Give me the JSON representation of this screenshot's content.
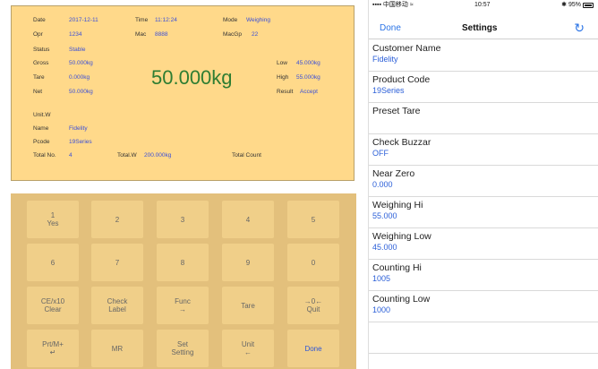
{
  "display": {
    "date_label": "Date",
    "date": "2017-12-11",
    "time_label": "Time",
    "time": "11:12:24",
    "mode_label": "Mode",
    "mode": "Weighing",
    "opr_label": "Opr",
    "opr": "1234",
    "mac_label": "Mac",
    "mac": "8888",
    "macgp_label": "MacGp",
    "macgp": "22",
    "status_label": "Status",
    "status": "Stable",
    "gross_label": "Gross",
    "gross": "50.000kg",
    "tare_label": "Tare",
    "tare": "0.000kg",
    "net_label": "Net",
    "net": "50.000kg",
    "big_weight": "50.000kg",
    "low_label": "Low",
    "low": "45.000kg",
    "high_label": "High",
    "high": "55.000kg",
    "result_label": "Result",
    "result": "Accept",
    "unitw_label": "Unit.W",
    "name_label": "Name",
    "name": "Fidelity",
    "pcode_label": "Pcode",
    "pcode": "19Series",
    "totalno_label": "Total No.",
    "totalno": "4",
    "totalw_label": "Total.W",
    "totalw": "200.000kg",
    "totalcount_label": "Total Count"
  },
  "keypad": {
    "keys": [
      {
        "l1": "1",
        "l2": "Yes"
      },
      {
        "l1": "2",
        "l2": ""
      },
      {
        "l1": "3",
        "l2": ""
      },
      {
        "l1": "4",
        "l2": ""
      },
      {
        "l1": "5",
        "l2": ""
      },
      {
        "l1": "6",
        "l2": ""
      },
      {
        "l1": "7",
        "l2": ""
      },
      {
        "l1": "8",
        "l2": ""
      },
      {
        "l1": "9",
        "l2": ""
      },
      {
        "l1": "0",
        "l2": ""
      },
      {
        "l1": "CE/x10",
        "l2": "Clear"
      },
      {
        "l1": "Check",
        "l2": "Label"
      },
      {
        "l1": "Func",
        "l2": "→"
      },
      {
        "l1": "Tare",
        "l2": ""
      },
      {
        "l1": "→0←",
        "l2": "Quit"
      },
      {
        "l1": "Prt/M+",
        "l2": "↵"
      },
      {
        "l1": "MR",
        "l2": ""
      },
      {
        "l1": "Set",
        "l2": "Setting"
      },
      {
        "l1": "Unit",
        "l2": "←"
      },
      {
        "l1": "Done",
        "l2": ""
      }
    ]
  },
  "phone": {
    "carrier": "中国移动",
    "clock": "10:57",
    "battery": "95%",
    "nav_done": "Done",
    "nav_title": "Settings",
    "rows": [
      {
        "label": "Customer Name",
        "value": "Fidelity"
      },
      {
        "label": "Product Code",
        "value": "19Series"
      },
      {
        "label": "Preset Tare",
        "value": ""
      },
      {
        "label": "Check Buzzar",
        "value": "OFF"
      },
      {
        "label": "Near Zero",
        "value": "0.000"
      },
      {
        "label": "Weighing Hi",
        "value": "55.000"
      },
      {
        "label": "Weighing Low",
        "value": "45.000"
      },
      {
        "label": "Counting Hi",
        "value": "1005"
      },
      {
        "label": "Counting Low",
        "value": "1000"
      }
    ]
  }
}
